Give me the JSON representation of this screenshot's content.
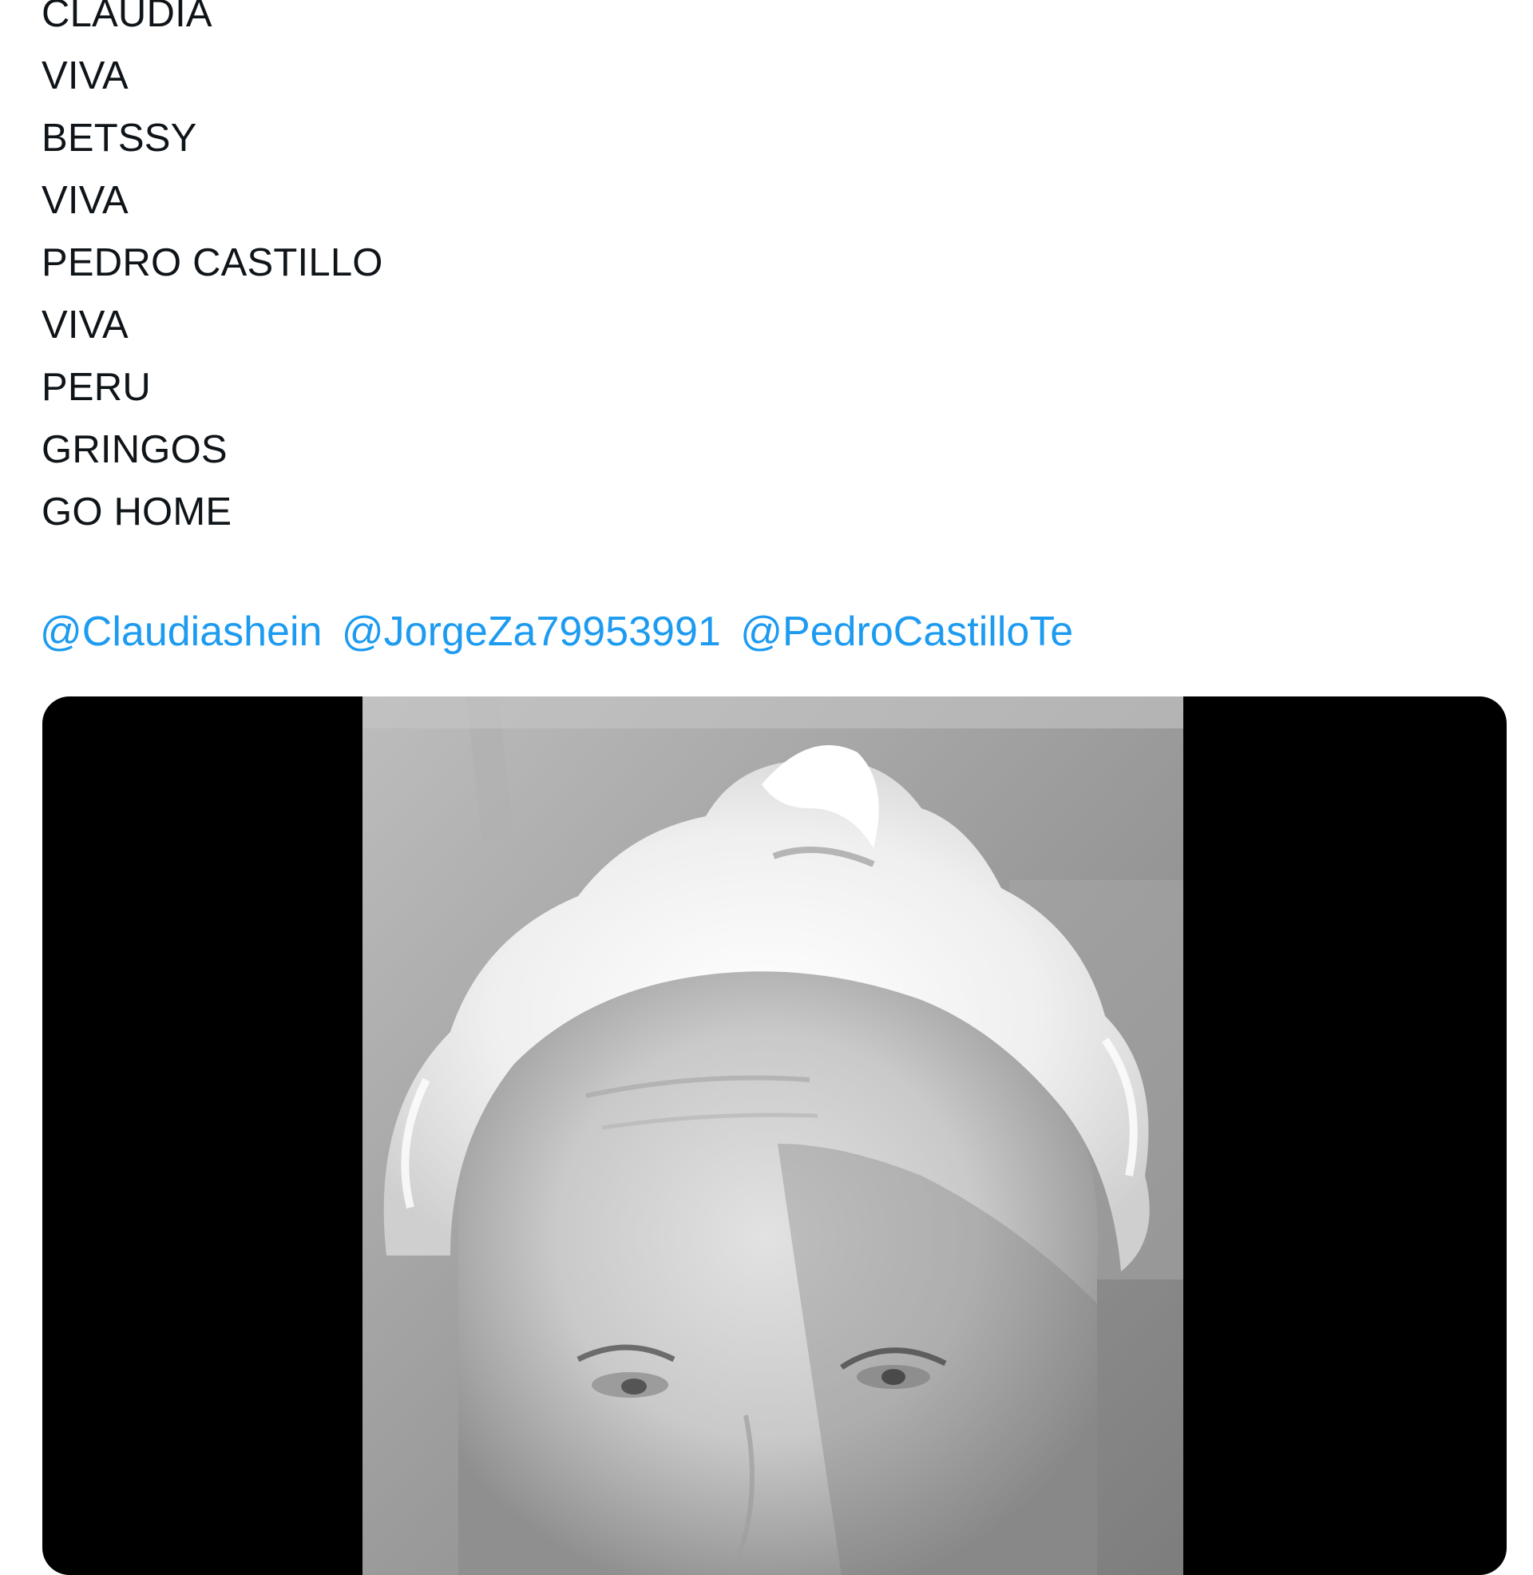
{
  "tweet": {
    "lines": [
      "CLAUDIA",
      "VIVA",
      "BETSSY",
      "VIVA",
      "PEDRO CASTILLO",
      "VIVA",
      "PERU",
      "GRINGOS",
      "GO HOME"
    ],
    "mentions": [
      "@Claudiashein",
      "@JorgeZa79953991",
      "@PedroCastilloTe"
    ]
  },
  "media": {
    "type": "video",
    "description_icon": "video-thumbnail-grayscale-portrait"
  },
  "colors": {
    "text": "#0f1419",
    "link": "#1d9bf0",
    "media_background": "#000000"
  }
}
